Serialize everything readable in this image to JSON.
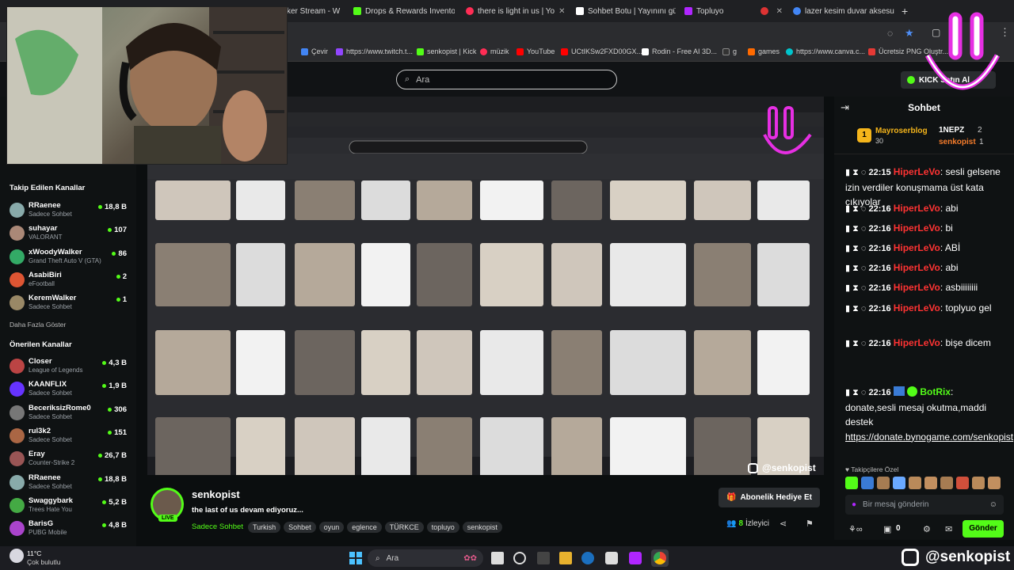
{
  "browser": {
    "tabs": [
      {
        "title": "ker Stream - W",
        "color": "#888888"
      },
      {
        "title": "Drops & Rewards Invento",
        "color": "#53fc18"
      },
      {
        "title": "there is light in us | Yo",
        "color": "#ff2d55"
      },
      {
        "title": "Sohbet Botu | Yayınını güç",
        "color": "#ffffff"
      },
      {
        "title": "Topluyo",
        "color": "#b026ff"
      },
      {
        "title": "",
        "color": "#d33"
      },
      {
        "title": "lazer kesim duvar aksesua",
        "color": "#4285f4"
      }
    ],
    "new_tab": "+",
    "bookmarks": [
      {
        "label": "Çevir",
        "color": "#4285f4"
      },
      {
        "label": "https://www.twitch.t...",
        "color": "#9146ff"
      },
      {
        "label": "senkopist | Kick",
        "color": "#53fc18"
      },
      {
        "label": "müzik",
        "color": "#ff2d55"
      },
      {
        "label": "YouTube",
        "color": "#ff0000"
      },
      {
        "label": "UCtIKSw2FXD00GX...",
        "color": "#ff0000"
      },
      {
        "label": "Rodin - Free AI 3D...",
        "color": "#ffffff"
      },
      {
        "label": "g",
        "color": "#333333"
      },
      {
        "label": "games",
        "color": "#ff6a00"
      },
      {
        "label": "https://www.canva.c...",
        "color": "#00c4cc"
      },
      {
        "label": "Ücretsiz PNG Oluştr...",
        "color": "#e53935"
      }
    ]
  },
  "kick": {
    "search_placeholder": "Ara",
    "ai_button": "KICK Satın Al"
  },
  "sidebar": {
    "followed_title": "Takip Edilen Kanallar",
    "followed": [
      {
        "name": "RRaenee",
        "game": "Sadece Sohbet",
        "viewers": "18,8 B",
        "color": "#8aa"
      },
      {
        "name": "suhayar",
        "game": "VALORANT",
        "viewers": "107",
        "color": "#a87"
      },
      {
        "name": "xWoodyWalker",
        "game": "Grand Theft Auto V (GTA)",
        "viewers": "86",
        "color": "#3a6"
      },
      {
        "name": "AsabiBiri",
        "game": "eFootball",
        "viewers": "2",
        "color": "#d53"
      },
      {
        "name": "KeremWalker",
        "game": "Sadece Sohbet",
        "viewers": "1",
        "color": "#986"
      }
    ],
    "show_more": "Daha Fazla Göster",
    "recommended_title": "Önerilen Kanallar",
    "recommended": [
      {
        "name": "Closer",
        "game": "League of Legends",
        "viewers": "4,3 B",
        "color": "#b44"
      },
      {
        "name": "KAANFLIX",
        "game": "Sadece Sohbet",
        "viewers": "1,9 B",
        "color": "#63f"
      },
      {
        "name": "BeceriksizRome0",
        "game": "Sadece Sohbet",
        "viewers": "306",
        "color": "#777"
      },
      {
        "name": "rul3k2",
        "game": "Sadece Sohbet",
        "viewers": "151",
        "color": "#a64"
      },
      {
        "name": "Eray",
        "game": "Counter-Strike 2",
        "viewers": "26,7 B",
        "color": "#955"
      },
      {
        "name": "RRaenee",
        "game": "Sadece Sohbet",
        "viewers": "18,8 B",
        "color": "#8aa"
      },
      {
        "name": "Swaggybark",
        "game": "Trees Hate You",
        "viewers": "5,2 B",
        "color": "#4a4"
      },
      {
        "name": "BarisG",
        "game": "PUBG Mobile",
        "viewers": "4,8 B",
        "color": "#a4c"
      }
    ]
  },
  "overlay": {
    "instagram_small": "@senkopist",
    "instagram_big": "@senkopist"
  },
  "stream": {
    "streamer": "senkopist",
    "live_badge": "LIVE",
    "title": "the last of us devam ediyoruz...",
    "category": "Sadece Sohbet",
    "tags": [
      "Turkish",
      "Sohbet",
      "oyun",
      "eglence",
      "TÜRKCE",
      "topluyo",
      "senkopist"
    ],
    "gift_button": "Abonelik Hediye Et",
    "viewers": "8",
    "viewers_label": "İzleyici"
  },
  "chat": {
    "title": "Sohbet",
    "leaderboard": [
      {
        "rank": "1",
        "name": "Mayroserblog",
        "score": "30"
      },
      {
        "name": "1NEPZ",
        "score": "2"
      },
      {
        "name": "senkopist",
        "score": "1"
      }
    ],
    "messages": [
      {
        "time": "22:15",
        "user": "HiperLeVo",
        "text": "sesli gelsene izin verdiler konuşmama üst kata çıkıyolar"
      },
      {
        "time": "22:16",
        "user": "HiperLeVo",
        "text": "abi"
      },
      {
        "time": "22:16",
        "user": "HiperLeVo",
        "text": "bi"
      },
      {
        "time": "22:16",
        "user": "HiperLeVo",
        "text": "ABİ"
      },
      {
        "time": "22:16",
        "user": "HiperLeVo",
        "text": "abi"
      },
      {
        "time": "22:16",
        "user": "HiperLeVo",
        "text": "asbiiiiiiii"
      },
      {
        "time": "22:16",
        "user": "HiperLeVo",
        "text": "toplyuo gel"
      },
      {
        "time": "22:16",
        "user": "HiperLeVo",
        "text": "bişe dicem"
      }
    ],
    "bot_message": {
      "time": "22:16",
      "user": "BotRix",
      "text": "donate,sesli mesaj okutma,maddi destek",
      "link": "https://donate.bynogame.com/senkopist"
    },
    "followers_only": "Takipçilere Özel",
    "input_placeholder": "Bir mesaj gönderin",
    "points": "0",
    "send_button": "Gönder"
  },
  "taskbar": {
    "weather_temp": "11°C",
    "weather_desc": "Çok bulutlu",
    "search": "Ara"
  }
}
